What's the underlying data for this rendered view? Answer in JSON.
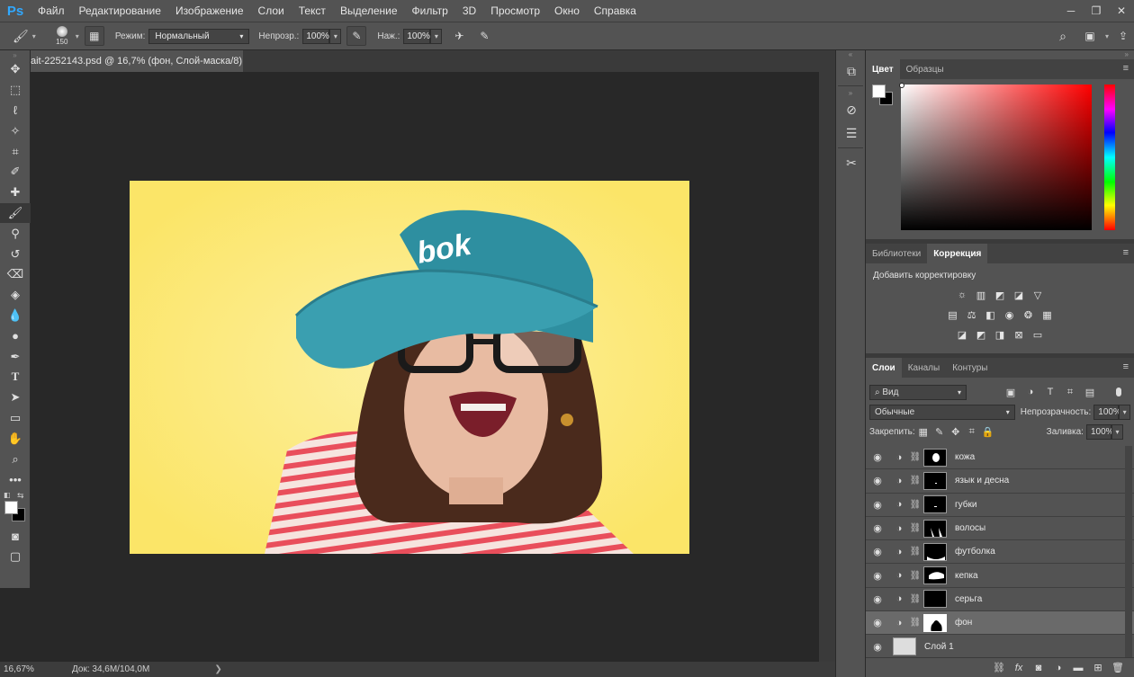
{
  "app": {
    "logo": "Ps"
  },
  "menu": [
    "Файл",
    "Редактирование",
    "Изображение",
    "Слои",
    "Текст",
    "Выделение",
    "Фильтр",
    "3D",
    "Просмотр",
    "Окно",
    "Справка"
  ],
  "window_controls": {
    "minimize": "─",
    "restore": "❐",
    "close": "✕"
  },
  "options": {
    "brush_size": "150",
    "mode_label": "Режим:",
    "mode_value": "Нормальный",
    "opacity_label": "Непрозр.:",
    "opacity_value": "100%",
    "flow_label": "Наж.:",
    "flow_value": "100%"
  },
  "document": {
    "tab_title": "ait-2252143.psd @ 16,7% (фон, Слой-маска/8)",
    "close": "×"
  },
  "status": {
    "zoom": "16,67%",
    "doc_info": "Док: 34,6M/104,0M",
    "arrow": "❯"
  },
  "color_panel": {
    "tabs": [
      "Цвет",
      "Образцы"
    ],
    "menu": "≡"
  },
  "adjustments_panel": {
    "tabs": [
      "Библиотеки",
      "Коррекция"
    ],
    "title": "Добавить корректировку",
    "menu": "≡"
  },
  "layers_panel": {
    "tabs": [
      "Слои",
      "Каналы",
      "Контуры"
    ],
    "menu": "≡",
    "filter_label": "Вид",
    "blend_mode": "Обычные",
    "opacity_label": "Непрозрачность:",
    "opacity_value": "100%",
    "lock_label": "Закрепить:",
    "fill_label": "Заливка:",
    "fill_value": "100%",
    "layers": [
      {
        "name": "кожа",
        "selected": false
      },
      {
        "name": "язык и десна",
        "selected": false
      },
      {
        "name": "губки",
        "selected": false
      },
      {
        "name": "волосы",
        "selected": false
      },
      {
        "name": "футболка",
        "selected": false
      },
      {
        "name": "кепка",
        "selected": false
      },
      {
        "name": "серьга",
        "selected": false
      },
      {
        "name": "фон",
        "selected": true
      },
      {
        "name": "Слой 1",
        "selected": false
      }
    ]
  },
  "image": {
    "cap_text": "bok",
    "colors": {
      "background": "#fbe770",
      "cap": "#2e8fa0",
      "shirt_stripe": "#e8465a"
    }
  }
}
